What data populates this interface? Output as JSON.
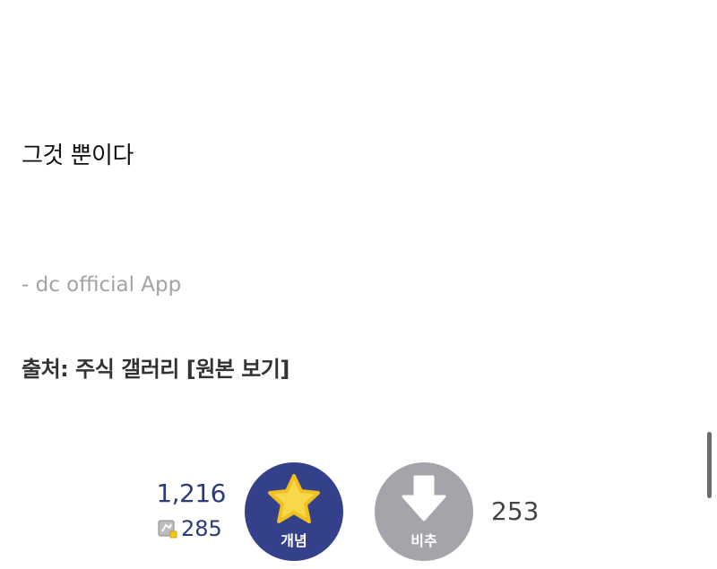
{
  "post": {
    "body_text": "그것 뿐이다",
    "app_signature": "- dc official App",
    "source_prefix": "출처: 주식 갤러리 ",
    "source_link": "[원본 보기]"
  },
  "recommend": {
    "up_count": "1,216",
    "fixed_count": "285",
    "up_label": "개념",
    "down_label": "비추",
    "down_count": "253"
  },
  "colors": {
    "up_button": "#34418a",
    "down_button": "#a3a5aa",
    "star": "#f8d749",
    "count_text": "#2d3a7a"
  },
  "icons": {
    "up": "star-icon",
    "down": "arrow-down-icon",
    "fixed": "fixed-user-icon"
  }
}
